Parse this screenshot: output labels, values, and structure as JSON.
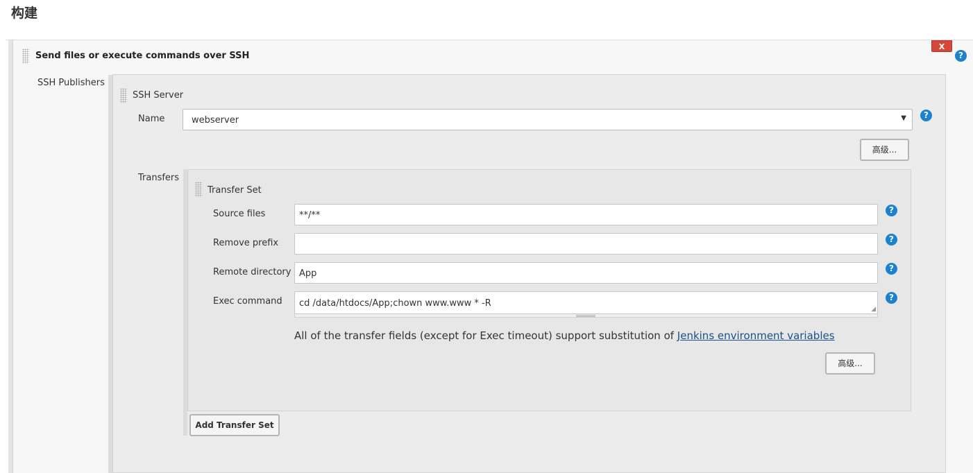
{
  "section": {
    "title": "构建"
  },
  "step": {
    "title": "Send files or execute commands over SSH",
    "delete_label": "X",
    "help_label": "?"
  },
  "publishers": {
    "label": "SSH Publishers",
    "server": {
      "title": "SSH Server",
      "name_label": "Name",
      "name_value": "webserver",
      "advanced_label": "高级..."
    },
    "transfers": {
      "label": "Transfers",
      "set_title": "Transfer Set",
      "fields": [
        {
          "label": "Source files",
          "value": "**/**"
        },
        {
          "label": "Remove prefix",
          "value": ""
        },
        {
          "label": "Remote directory",
          "value": "App"
        },
        {
          "label": "Exec command",
          "value": "cd /data/htdocs/App;chown www.www * -R"
        }
      ],
      "note_text": "All of the transfer fields (except for Exec timeout) support substitution of ",
      "note_link": "Jenkins environment variables",
      "advanced_label": "高级...",
      "add_label": "Add Transfer Set"
    }
  },
  "colors": {
    "delete": "#d24939",
    "help": "#1b82d1",
    "link": "#1a4f8b"
  }
}
